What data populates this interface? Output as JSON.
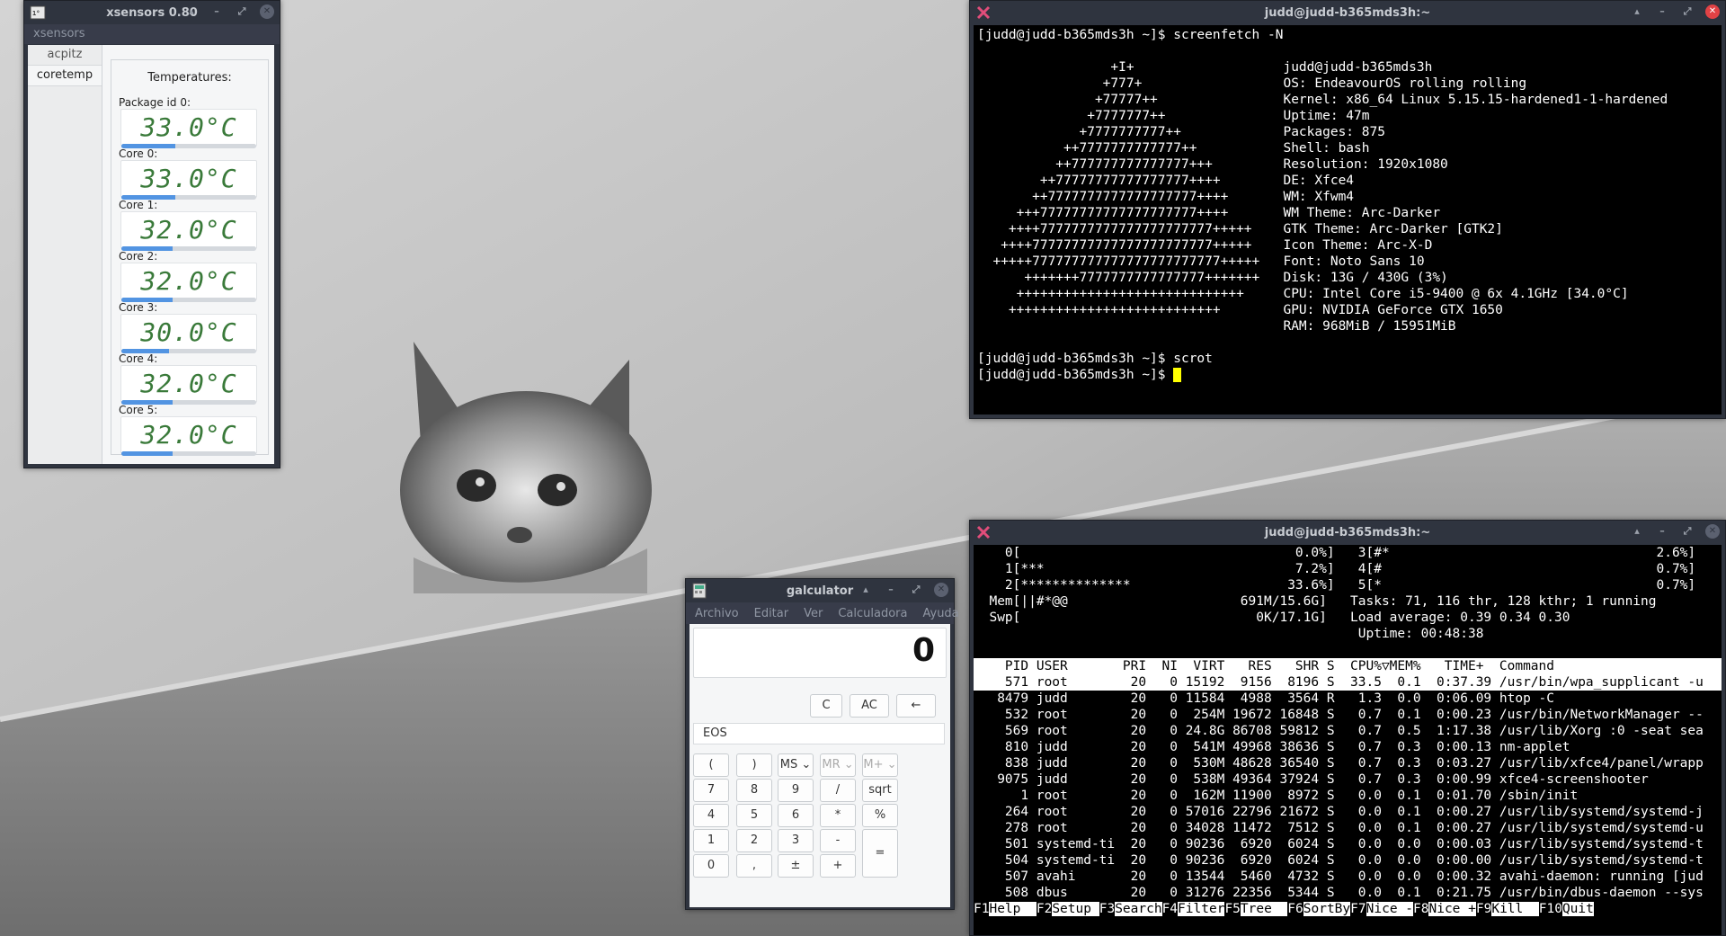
{
  "xsensors": {
    "title": "xsensors 0.80",
    "menu": "xsensors",
    "tabs": [
      "acpitz",
      "coretemp"
    ],
    "panel_title": "Temperatures:",
    "sensors": [
      {
        "label": "Package id 0:",
        "value": "33.0°C",
        "level": 0.4
      },
      {
        "label": "Core 0:",
        "value": "33.0°C",
        "level": 0.4
      },
      {
        "label": "Core 1:",
        "value": "32.0°C",
        "level": 0.38
      },
      {
        "label": "Core 2:",
        "value": "32.0°C",
        "level": 0.38
      },
      {
        "label": "Core 3:",
        "value": "30.0°C",
        "level": 0.35
      },
      {
        "label": "Core 4:",
        "value": "32.0°C",
        "level": 0.38
      },
      {
        "label": "Core 5:",
        "value": "32.0°C",
        "level": 0.38
      }
    ]
  },
  "term1": {
    "title": "judd@judd-b365mds3h:~",
    "lines": [
      "[judd@judd-b365mds3h ~]$ screenfetch -N",
      "",
      "                 +I+                   judd@judd-b365mds3h",
      "                +777+                  OS: EndeavourOS rolling rolling",
      "               +77777++                Kernel: x86_64 Linux 5.15.15-hardened1-1-hardened",
      "              +7777777++               Uptime: 47m",
      "             +7777777777++             Packages: 875",
      "           ++7777777777777++           Shell: bash",
      "          ++777777777777777+++         Resolution: 1920x1080",
      "        ++77777777777777777++++        DE: Xfce4",
      "       ++7777777777777777777++++       WM: Xfwm4",
      "     +++77777777777777777777++++       WM Theme: Arc-Darker",
      "    ++++7777777777777777777777+++++    GTK Theme: Arc-Darker [GTK2]",
      "   ++++77777777777777777777777+++++    Icon Theme: Arc-X-D",
      "  +++++777777777777777777777777+++++   Font: Noto Sans 10",
      "      +++++++7777777777777777+++++++   Disk: 13G / 430G (3%)",
      "     +++++++++++++++++++++++++++++     CPU: Intel Core i5-9400 @ 6x 4.1GHz [34.0°C]",
      "    +++++++++++++++++++++++++++        GPU: NVIDIA GeForce GTX 1650",
      "                                       RAM: 968MiB / 15951MiB",
      "",
      "[judd@judd-b365mds3h ~]$ scrot",
      "[judd@judd-b365mds3h ~]$ "
    ]
  },
  "term2": {
    "title": "judd@judd-b365mds3h:~",
    "meters": [
      "    0[                                   0.0%]   3[#*                                  2.6%]",
      "    1[***                                7.2%]   4[#                                   0.7%]",
      "    2[**************                    33.6%]   5[*                                   0.7%]",
      "  Mem[||#*@@                      691M/15.6G]   Tasks: 71, 116 thr, 128 kthr; 1 running",
      "  Swp[                              0K/17.1G]   Load average: 0.39 0.34 0.30",
      "                                                 Uptime: 00:48:38"
    ],
    "header": "    PID USER       PRI  NI  VIRT   RES   SHR S  CPU%▽MEM%   TIME+  Command",
    "rows": [
      "    571 root        20   0 15192  9156  8196 S  33.5  0.1  0:37.39 /usr/bin/wpa_supplicant -u",
      "   8479 judd        20   0 11584  4988  3564 R   1.3  0.0  0:06.09 htop -C",
      "    532 root        20   0  254M 19672 16848 S   0.7  0.1  0:00.23 /usr/bin/NetworkManager --",
      "    569 root        20   0 24.8G 86708 59812 S   0.7  0.5  1:17.38 /usr/lib/Xorg :0 -seat sea",
      "    810 judd        20   0  541M 49968 38636 S   0.7  0.3  0:00.13 nm-applet",
      "    838 judd        20   0  530M 48628 36540 S   0.7  0.3  0:03.27 /usr/lib/xfce4/panel/wrapp",
      "   9075 judd        20   0  538M 49364 37924 S   0.7  0.3  0:00.99 xfce4-screenshooter",
      "      1 root        20   0  162M 11900  8972 S   0.0  0.1  0:01.70 /sbin/init",
      "    264 root        20   0 57016 22796 21672 S   0.0  0.1  0:00.27 /usr/lib/systemd/systemd-j",
      "    278 root        20   0 34028 11472  7512 S   0.0  0.1  0:00.27 /usr/lib/systemd/systemd-u",
      "    501 systemd-ti  20   0 90236  6920  6024 S   0.0  0.0  0:00.03 /usr/lib/systemd/systemd-t",
      "    504 systemd-ti  20   0 90236  6920  6024 S   0.0  0.0  0:00.00 /usr/lib/systemd/systemd-t",
      "    507 avahi       20   0 13544  5460  4732 S   0.0  0.0  0:00.32 avahi-daemon: running [jud",
      "    508 dbus        20   0 31276 22356  5344 S   0.0  0.1  0:21.75 /usr/bin/dbus-daemon --sys"
    ],
    "fkeys": [
      {
        "key": "F1",
        "label": "Help  "
      },
      {
        "key": "F2",
        "label": "Setup "
      },
      {
        "key": "F3",
        "label": "Search"
      },
      {
        "key": "F4",
        "label": "Filter"
      },
      {
        "key": "F5",
        "label": "Tree  "
      },
      {
        "key": "F6",
        "label": "SortBy"
      },
      {
        "key": "F7",
        "label": "Nice -"
      },
      {
        "key": "F8",
        "label": "Nice +"
      },
      {
        "key": "F9",
        "label": "Kill  "
      },
      {
        "key": "F10",
        "label": "Quit"
      }
    ]
  },
  "galculator": {
    "title": "galculator",
    "menu": [
      "Archivo",
      "Editar",
      "Ver",
      "Calculadora",
      "Ayuda"
    ],
    "display": "0",
    "mode": "EOS",
    "top_buttons": [
      "C",
      "AC",
      "←"
    ],
    "buttons": [
      [
        "(",
        ")",
        "MS ⌄",
        "MR ⌄",
        "M+ ⌄"
      ],
      [
        "7",
        "8",
        "9",
        "/",
        "sqrt"
      ],
      [
        "4",
        "5",
        "6",
        "*",
        "%"
      ],
      [
        "1",
        "2",
        "3",
        "-",
        "="
      ],
      [
        "0",
        ",",
        "±",
        "+"
      ]
    ]
  },
  "colors": {
    "titlebar": "#2f343f",
    "accent": "#5294e2",
    "lcd_text": "#3a7a3a",
    "terminal_bg": "#000000",
    "cursor": "#ffff00",
    "close_red": "#e14245"
  }
}
